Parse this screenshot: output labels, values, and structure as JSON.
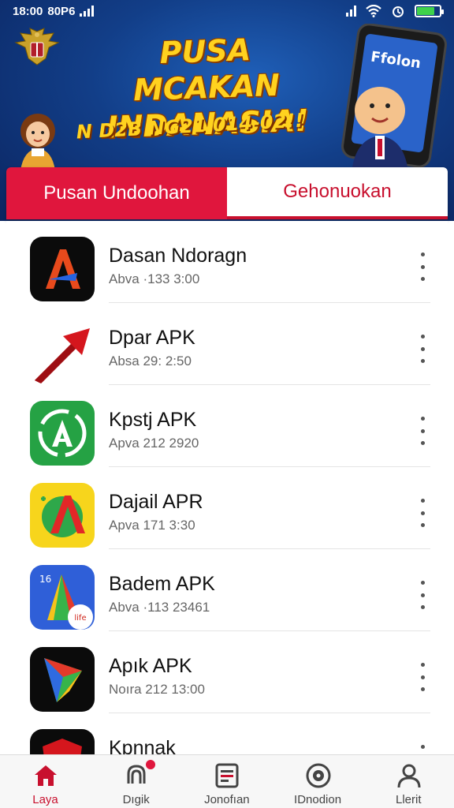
{
  "status_bar": {
    "time": "18:00",
    "carrier": "80P6"
  },
  "banner": {
    "headline_line1": "PUSA MCAKAN",
    "headline_line2": "INDANASIA!",
    "subline": "N D2B NG21 014-02!!",
    "phone_text": "Ffolon"
  },
  "tabs": [
    {
      "label": "Pusan Undoohan",
      "active": false
    },
    {
      "label": "Gehonuokan",
      "active": true
    }
  ],
  "apps": [
    {
      "name": "Dasan Ndoragn",
      "meta": "Abva ·133 3:00",
      "icon": "a-logo-black-icon"
    },
    {
      "name": "Dpar APK",
      "meta": "Absa  29: 2:50",
      "icon": "red-arrow-icon"
    },
    {
      "name": "Kpstj APK",
      "meta": "Apva  212 2920",
      "icon": "green-recycle-a-icon"
    },
    {
      "name": "Dajail APR",
      "meta": "Apva  171 3:30",
      "icon": "yellow-a-icon"
    },
    {
      "name": "Badem APK",
      "meta": "Abva ·113 23461",
      "icon": "blue-triangle-icon"
    },
    {
      "name": "Apık APK",
      "meta": "Noıra  212 13:00",
      "icon": "play-triangle-icon"
    },
    {
      "name": "Kpnnak",
      "meta": "",
      "icon": "shield-app-icon"
    }
  ],
  "bottom_nav": [
    {
      "label": "Laya",
      "icon": "home-icon",
      "active": true
    },
    {
      "label": "Dıgik",
      "icon": "notification-icon",
      "active": false
    },
    {
      "label": "Jonofıan",
      "icon": "document-icon",
      "active": false
    },
    {
      "label": "IDnodion",
      "icon": "disc-icon",
      "active": false
    },
    {
      "label": "Llerit",
      "icon": "user-icon",
      "active": false
    }
  ],
  "colors": {
    "accent": "#e0163d",
    "banner_bg": "#123e88",
    "headline": "#ffd21f"
  }
}
